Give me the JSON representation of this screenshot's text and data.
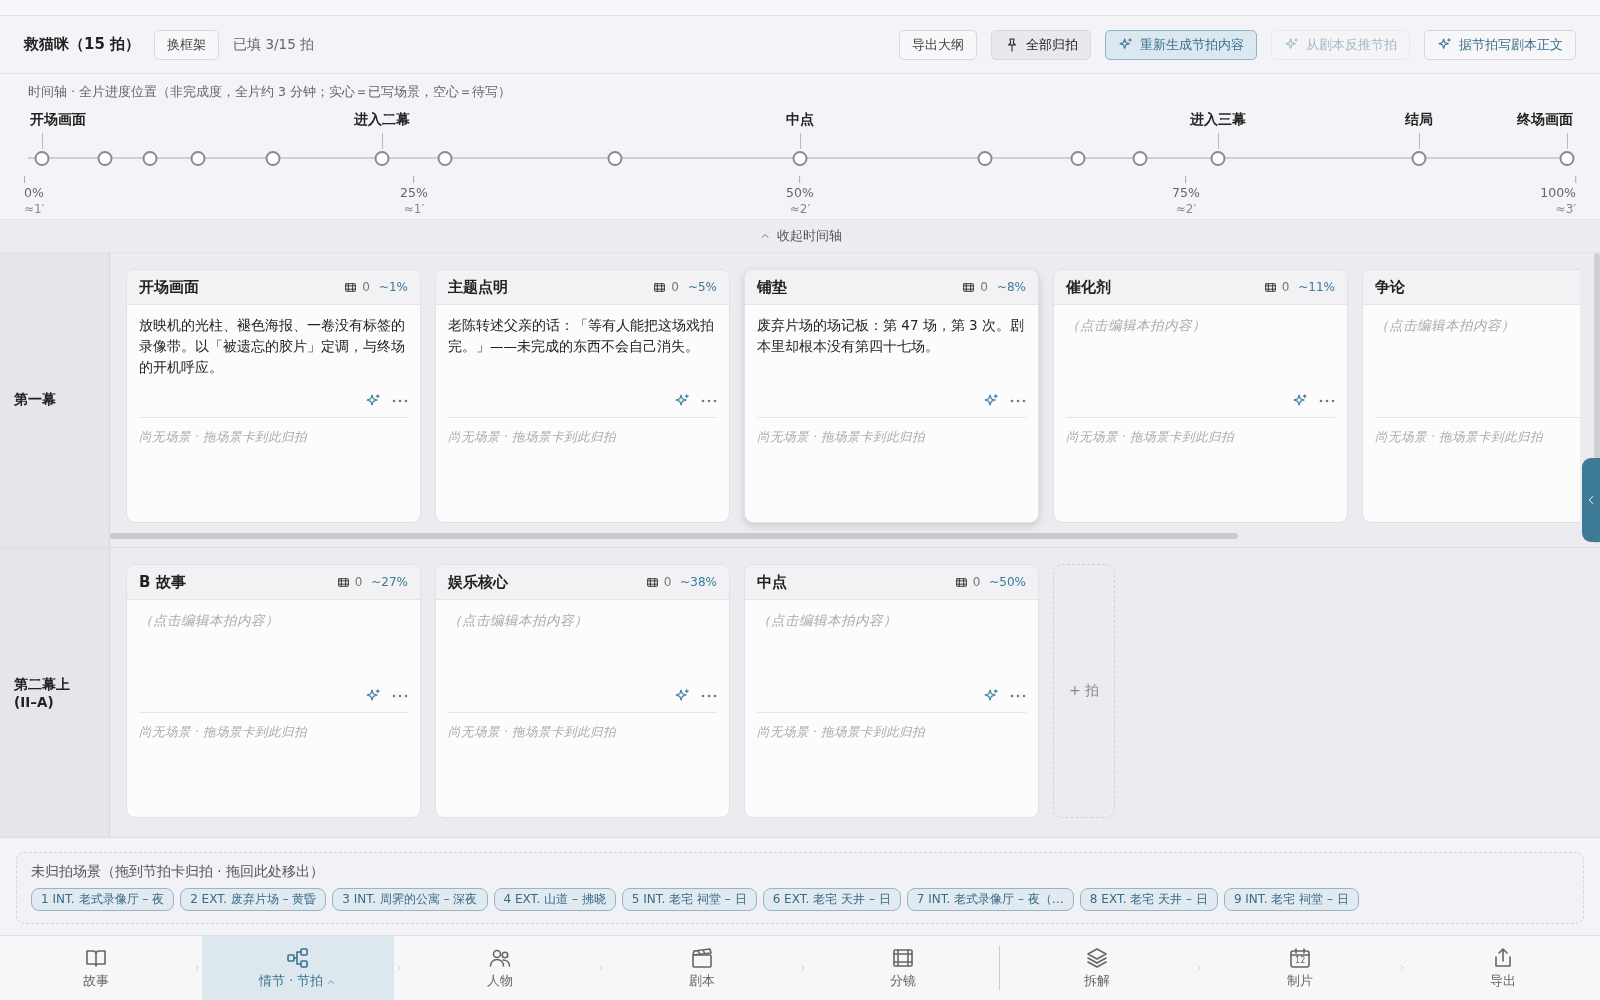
{
  "header": {
    "title": "救猫咪（15 拍）",
    "framework_button": "换框架",
    "filled": "已填 3/15 拍",
    "actions": [
      {
        "label": "导出大纲",
        "kind": "plain",
        "primary": false,
        "disabled": false
      },
      {
        "label": "全部归拍",
        "kind": "toggle",
        "primary": false,
        "disabled": false
      },
      {
        "label": "重新生成节拍内容",
        "kind": "ai",
        "primary": true,
        "disabled": false
      },
      {
        "label": "从剧本反推节拍",
        "kind": "ai",
        "primary": false,
        "disabled": true
      },
      {
        "label": "据节拍写剧本正文",
        "kind": "ai",
        "primary": false,
        "disabled": false
      }
    ]
  },
  "timeline": {
    "caption": "时间轴 · 全片进度位置（非完成度，全片约 3 分钟；实心＝已写场景，空心＝待写）",
    "dots": [
      {
        "level": 0.009,
        "filled": false,
        "label": "开场画面"
      },
      {
        "level": 0.05,
        "filled": false
      },
      {
        "level": 0.079,
        "filled": false
      },
      {
        "level": 0.11,
        "filled": false
      },
      {
        "level": 0.159,
        "filled": false
      },
      {
        "level": 0.229,
        "filled": false,
        "label": "进入二幕"
      },
      {
        "level": 0.27,
        "filled": false
      },
      {
        "level": 0.38,
        "filled": false
      },
      {
        "level": 0.5,
        "filled": false,
        "label": "中点"
      },
      {
        "level": 0.62,
        "filled": false
      },
      {
        "level": 0.68,
        "filled": false
      },
      {
        "level": 0.72,
        "filled": false
      },
      {
        "level": 0.771,
        "filled": false,
        "label": "进入三幕"
      },
      {
        "level": 0.901,
        "filled": false,
        "label": "结局"
      },
      {
        "level": 0.997,
        "filled": false,
        "label": "终场画面"
      }
    ],
    "ticks": [
      {
        "percent": "0%",
        "minutes": "≈1′"
      },
      {
        "percent": "25%",
        "minutes": "≈1′"
      },
      {
        "percent": "50%",
        "minutes": "≈2′"
      },
      {
        "percent": "75%",
        "minutes": "≈2′"
      },
      {
        "percent": "100%",
        "minutes": "≈3′"
      }
    ],
    "collapse": "收起时间轴"
  },
  "acts": [
    {
      "name": "第一幕",
      "beats": [
        {
          "title": "开场画面",
          "scenes": "0",
          "position": "~1%",
          "text": "放映机的光柱、褪色海报、一卷没有标签的录像带。以「被遗忘的胶片」定调，与终场的开机呼应。",
          "empty_hint": "尚无场景 · 拖场景卡到此归拍",
          "raised": false
        },
        {
          "title": "主题点明",
          "scenes": "0",
          "position": "~5%",
          "text": "老陈转述父亲的话：「等有人能把这场戏拍完。」——未完成的东西不会自己消失。",
          "empty_hint": "尚无场景 · 拖场景卡到此归拍",
          "raised": false
        },
        {
          "title": "铺垫",
          "scenes": "0",
          "position": "~8%",
          "text": "废弃片场的场记板：第 47 场，第 3 次。剧本里却根本没有第四十七场。",
          "empty_hint": "尚无场景 · 拖场景卡到此归拍",
          "raised": true
        },
        {
          "title": "催化剂",
          "scenes": "0",
          "position": "~11%",
          "placeholder": "（点击编辑本拍内容）",
          "empty_hint": "尚无场景 · 拖场景卡到此归拍",
          "raised": false
        },
        {
          "title": "争论",
          "placeholder": "（点击编辑本拍内容）",
          "empty_hint": "尚无场景 · 拖场景卡到此归拍",
          "raised": false
        }
      ]
    },
    {
      "name": "第二幕上\n(II–A)",
      "add_beat": "+ 拍",
      "beats": [
        {
          "title": "B 故事",
          "scenes": "0",
          "position": "~27%",
          "placeholder": "（点击编辑本拍内容）",
          "empty_hint": "尚无场景 · 拖场景卡到此归拍",
          "raised": false
        },
        {
          "title": "娱乐核心",
          "scenes": "0",
          "position": "~38%",
          "placeholder": "（点击编辑本拍内容）",
          "empty_hint": "尚无场景 · 拖场景卡到此归拍",
          "raised": false
        },
        {
          "title": "中点",
          "scenes": "0",
          "position": "~50%",
          "placeholder": "（点击编辑本拍内容）",
          "empty_hint": "尚无场景 · 拖场景卡到此归拍",
          "raised": false
        }
      ]
    }
  ],
  "unassigned": {
    "caption": "未归拍场景（拖到节拍卡归拍 · 拖回此处移出）",
    "scenes": [
      "1 INT. 老式录像厅 – 夜",
      "2 EXT. 废弃片场 – 黄昏",
      "3 INT. 周霁的公寓 – 深夜",
      "4 EXT. 山道 – 拂晓",
      "5 INT. 老宅 祠堂 – 日",
      "6 EXT. 老宅 天井 – 日",
      "7 INT. 老式录像厅 – 夜（…",
      "8 EXT. 老宅 天井 – 日",
      "9 INT. 老宅 祠堂 – 日"
    ]
  },
  "nav": {
    "groups": [
      [
        {
          "label": "故事",
          "kind": "book",
          "selected": false
        },
        {
          "label": "情节 · 节拍",
          "kind": "nodes",
          "selected": true
        },
        {
          "label": "人物",
          "kind": "people",
          "selected": false
        },
        {
          "label": "剧本",
          "kind": "clapper",
          "selected": false
        },
        {
          "label": "分镜",
          "kind": "film",
          "selected": false
        }
      ],
      [
        {
          "label": "拆解",
          "kind": "layers",
          "selected": false
        },
        {
          "label": "制片",
          "kind": "calendar",
          "icon_text": "12",
          "selected": false
        },
        {
          "label": "导出",
          "kind": "share",
          "selected": false
        }
      ]
    ]
  }
}
